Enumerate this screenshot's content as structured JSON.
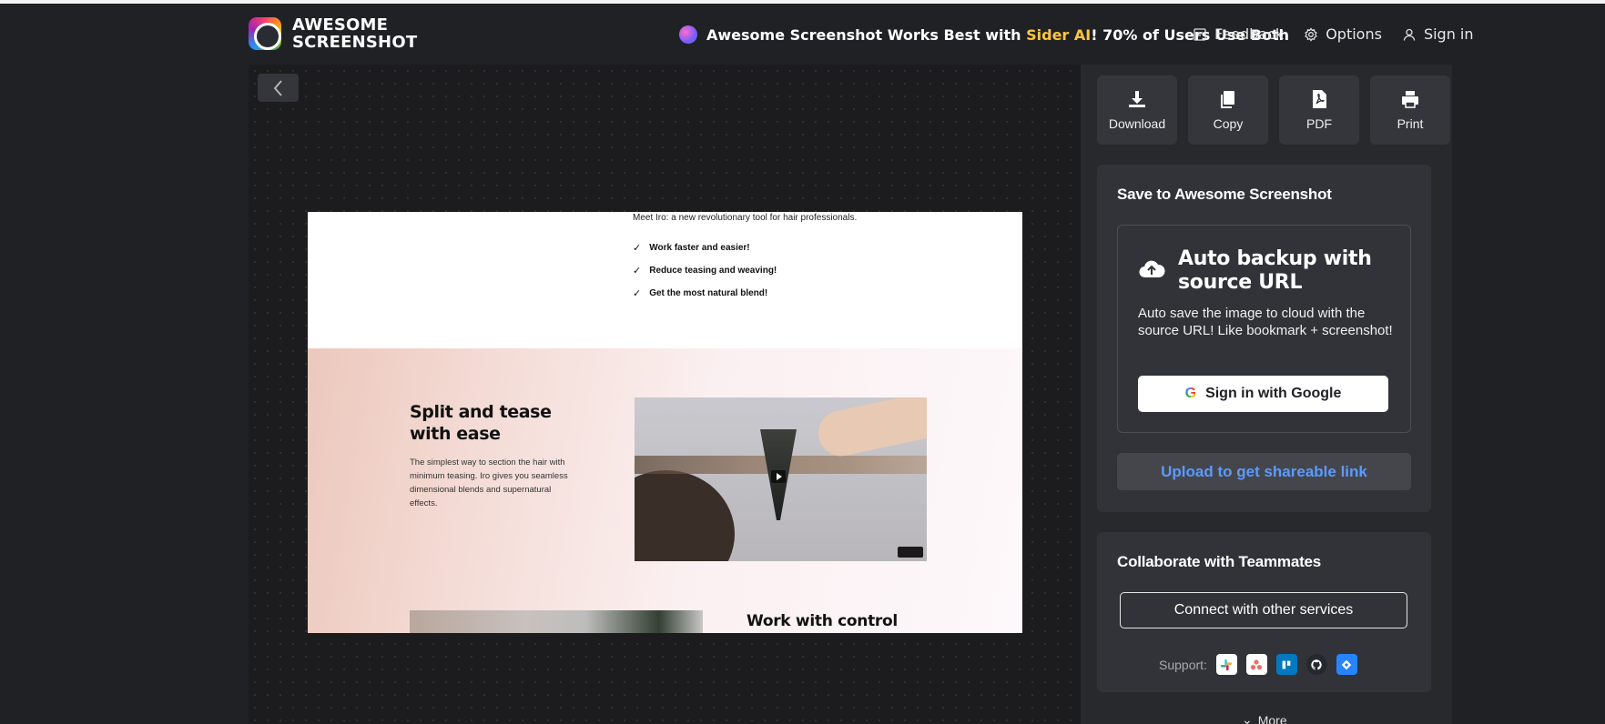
{
  "header": {
    "logo_line1": "AWESOME",
    "logo_line2": "SCREENSHOT",
    "promo_prefix": "Awesome Screenshot Works Best with ",
    "promo_highlight": "Sider AI",
    "promo_suffix": "! 70% of Users Use Both",
    "feedback": "Feedback",
    "options": "Options",
    "sign_in": "Sign in"
  },
  "screenshot": {
    "intro": "Meet Iro: a new revolutionary tool for hair professionals.",
    "checks": [
      "Work faster and easier!",
      "Reduce teasing and weaving!",
      "Get the most natural blend!"
    ],
    "section_title": "Split and tease with ease",
    "section_text": "The simplest way to section the hair with minimum teasing. Iro gives you seamless dimensional blends and supernatural effects.",
    "next_title": "Work with control"
  },
  "actions": {
    "download": "Download",
    "copy": "Copy",
    "pdf": "PDF",
    "print": "Print"
  },
  "save": {
    "title": "Save to Awesome Screenshot",
    "backup_title": "Auto backup with source URL",
    "backup_desc": "Auto save the image to cloud with the source URL! Like bookmark + screenshot!",
    "google_btn": "Sign in with Google",
    "upload_btn": "Upload to get shareable link"
  },
  "collab": {
    "title": "Collaborate with Teammates",
    "connect_btn": "Connect with other services",
    "support_label": "Support:",
    "services": [
      "slack-icon",
      "asana-icon",
      "trello-icon",
      "github-icon",
      "jira-icon"
    ],
    "more": "More"
  },
  "colors": {
    "background": "#202124",
    "panel": "#28292d",
    "highlight": "#ffc542",
    "link_blue": "#5b9bff"
  }
}
